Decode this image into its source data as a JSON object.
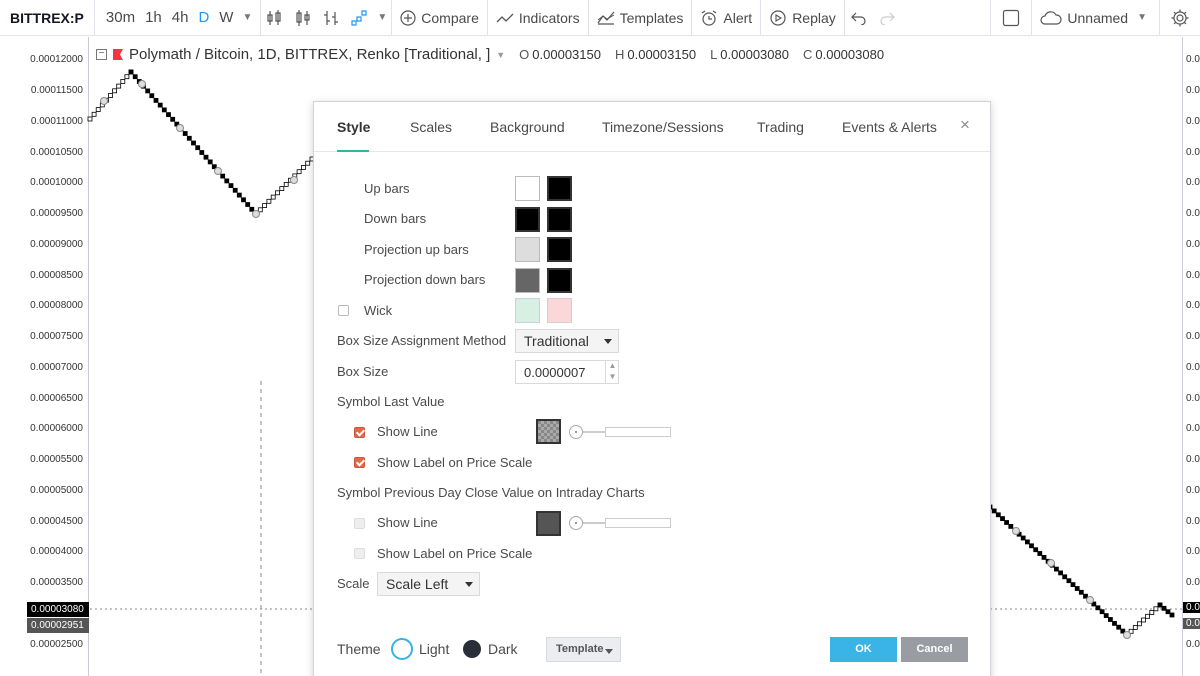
{
  "toolbar": {
    "symbol": "BITTREX:P",
    "intervals": [
      "30m",
      "1h",
      "4h",
      "D",
      "W"
    ],
    "active_interval": "D",
    "compare_label": "Compare",
    "indicators_label": "Indicators",
    "templates_label": "Templates",
    "alert_label": "Alert",
    "replay_label": "Replay",
    "layout_name": "Unnamed"
  },
  "legend": {
    "title": "Polymath / Bitcoin, 1D, BITTREX, Renko [Traditional, ]",
    "o_key": "O",
    "o_val": "0.00003150",
    "h_key": "H",
    "h_val": "0.00003150",
    "l_key": "L",
    "l_val": "0.00003080",
    "c_key": "C",
    "c_val": "0.00003080"
  },
  "price_scale": {
    "ticks": [
      "0.00012000",
      "0.00011500",
      "0.00011000",
      "0.00010500",
      "0.00010000",
      "0.00009500",
      "0.00009000",
      "0.00008500",
      "0.00008000",
      "0.00007500",
      "0.00007000",
      "0.00006500",
      "0.00006000",
      "0.00005500",
      "0.00005000",
      "0.00004500",
      "0.00004000",
      "0.00003500",
      "0.00003000",
      "0.00002500"
    ],
    "right_ticks": [
      "0.0",
      "0.0",
      "0.0",
      "0.0",
      "0.0",
      "0.0",
      "0.0",
      "0.0",
      "0.0",
      "0.0",
      "0.0",
      "0.0",
      "0.0",
      "0.0",
      "0.0",
      "0.0",
      "0.0",
      "0.0",
      "0.0",
      "0.0"
    ],
    "last_price": "0.00003080",
    "prev_close": "0.00002951",
    "last_price_color": "#000000",
    "prev_close_color": "#555555"
  },
  "dialog": {
    "tabs": [
      "Style",
      "Scales",
      "Background",
      "Timezone/Sessions",
      "Trading",
      "Events & Alerts"
    ],
    "active_tab": "Style",
    "close_glyph": "×",
    "up_bars": "Up bars",
    "down_bars": "Down bars",
    "proj_up_bars": "Projection up bars",
    "proj_down_bars": "Projection down bars",
    "wick": "Wick",
    "box_method_label": "Box Size Assignment Method",
    "box_method_value": "Traditional",
    "box_size_label": "Box Size",
    "box_size_value": "0.0000007",
    "symbol_last_value": "Symbol Last Value",
    "show_line": "Show Line",
    "show_label": "Show Label on Price Scale",
    "prev_day_close": "Symbol Previous Day Close Value on Intraday Charts",
    "show_line_2": "Show Line",
    "show_label_2": "Show Label on Price Scale",
    "scale_label": "Scale",
    "scale_value": "Scale Left",
    "theme_label": "Theme",
    "light_label": "Light",
    "dark_label": "Dark",
    "template_label": "Template",
    "ok_label": "OK",
    "cancel_label": "Cancel",
    "colors": {
      "up_body": "#ffffff",
      "up_border": "#000000",
      "down_body": "#000000",
      "down_border": "#000000",
      "proj_up_body": "#dddddd",
      "proj_up_border": "#000000",
      "proj_down_body": "#666666",
      "proj_down_border": "#000000",
      "wick_up": "#d6f0e4",
      "wick_down": "#fbd7da"
    },
    "checks": {
      "wick": false,
      "last_show_line": true,
      "last_show_label": true,
      "prev_show_line": false,
      "prev_show_label": false
    }
  }
}
